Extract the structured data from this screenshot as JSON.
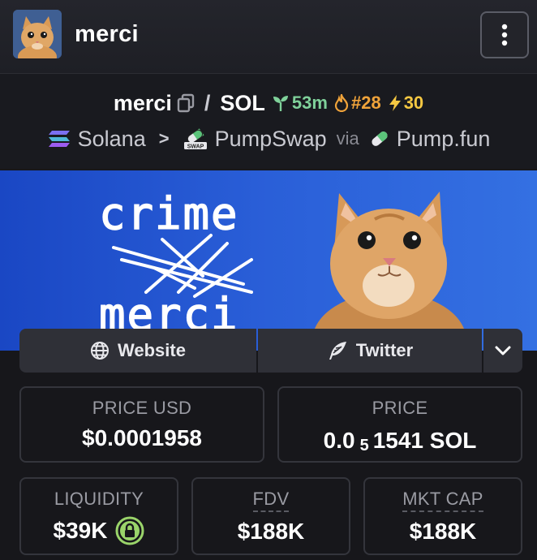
{
  "header": {
    "title": "merci"
  },
  "pair": {
    "base": "merci",
    "separator": "/",
    "quote": "SOL",
    "age": "53m",
    "rank": "#28",
    "boosts": "30",
    "chain": "Solana",
    "chevron": ">",
    "dex": "PumpSwap",
    "via_label": "via",
    "launchpad": "Pump.fun"
  },
  "banner": {
    "text_top": "crime",
    "text_bottom": "merci"
  },
  "links": {
    "website_label": "Website",
    "twitter_label": "Twitter"
  },
  "stats": {
    "price_usd_label": "PRICE USD",
    "price_usd_value": "$0.0001958",
    "price_label": "PRICE",
    "price_prefix": "0.0",
    "price_subscript": "5",
    "price_suffix": "1541 SOL",
    "liquidity_label": "LIQUIDITY",
    "liquidity_value": "$39K",
    "fdv_label": "FDV",
    "fdv_value": "$188K",
    "mktcap_label": "MKT CAP",
    "mktcap_value": "$188K"
  },
  "colors": {
    "age": "#7fd19a",
    "rank": "#f0a33a",
    "boost": "#f5c842",
    "lock": "#9ad46a",
    "banner": "#2a60d8"
  },
  "icons": [
    "cat-avatar-icon",
    "kebab-menu-icon",
    "copy-icon",
    "seedling-icon",
    "flame-icon",
    "lightning-icon",
    "solana-icon",
    "pumpswap-icon",
    "pill-icon",
    "globe-icon",
    "feather-icon",
    "chevron-down-icon",
    "lock-icon"
  ]
}
